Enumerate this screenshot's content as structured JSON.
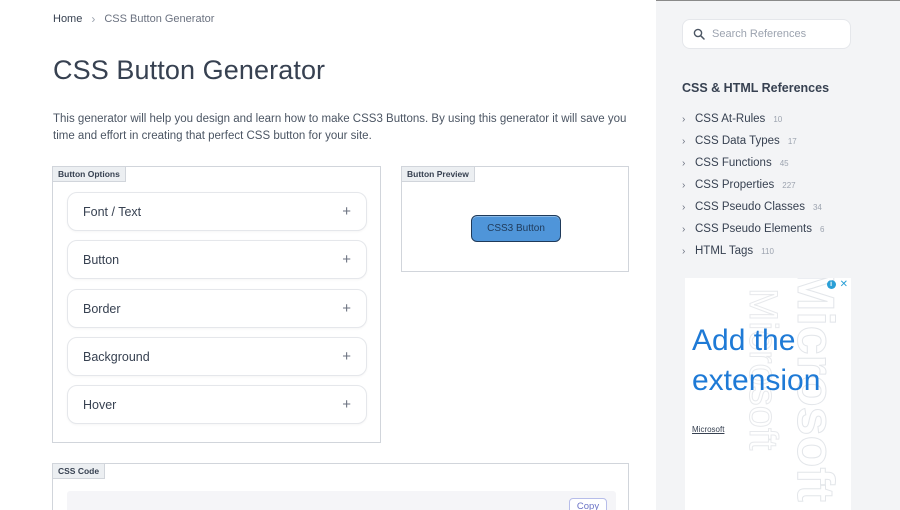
{
  "breadcrumb": {
    "home": "Home",
    "separator": "›",
    "current": "CSS Button Generator"
  },
  "page": {
    "title": "CSS Button Generator",
    "intro": "This generator will help you design and learn how to make CSS3 Buttons. By using this generator it will save you time and effort in creating that perfect CSS button for your site."
  },
  "options_panel": {
    "label": "Button Options",
    "sections": [
      {
        "label": "Font / Text",
        "icon": "+"
      },
      {
        "label": "Button",
        "icon": "+"
      },
      {
        "label": "Border",
        "icon": "+"
      },
      {
        "label": "Background",
        "icon": "+"
      },
      {
        "label": "Hover",
        "icon": "+"
      }
    ]
  },
  "preview_panel": {
    "label": "Button Preview",
    "button_text": "CSS3 Button"
  },
  "code_panel": {
    "label": "CSS Code",
    "copy_label": "Copy"
  },
  "sidebar": {
    "search_placeholder": "Search References",
    "title": "CSS & HTML References",
    "items": [
      {
        "label": "CSS At-Rules",
        "count": "10"
      },
      {
        "label": "CSS Data Types",
        "count": "17"
      },
      {
        "label": "CSS Functions",
        "count": "45"
      },
      {
        "label": "CSS Properties",
        "count": "227"
      },
      {
        "label": "CSS Pseudo Classes",
        "count": "34"
      },
      {
        "label": "CSS Pseudo Elements",
        "count": "6"
      },
      {
        "label": "HTML Tags",
        "count": "110"
      }
    ],
    "chevron": "›"
  },
  "ad": {
    "headline": "Add the extension",
    "brand": "Microsoft",
    "info_icon": "i",
    "close_icon": "✕"
  },
  "colors": {
    "preview_button_bg": "#4f95d9",
    "preview_button_border": "#1f3a5a",
    "ad_headline": "#1e7ad6",
    "sidebar_bg": "#f3f4f6"
  }
}
